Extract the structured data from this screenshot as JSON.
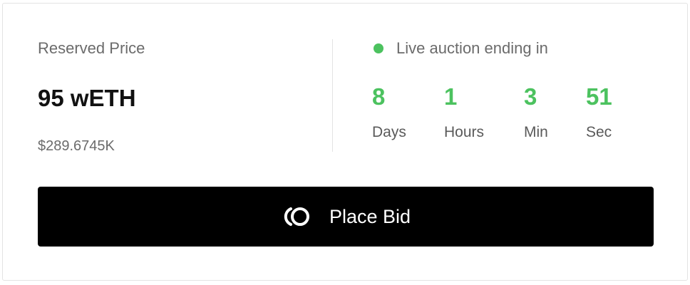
{
  "reserved": {
    "label": "Reserved Price",
    "amount": "95 wETH",
    "usd": "$289.6745K"
  },
  "auction": {
    "status_text": "Live auction ending in",
    "status_color": "#4cc25f",
    "countdown": [
      {
        "value": "8",
        "label": "Days"
      },
      {
        "value": "1",
        "label": "Hours"
      },
      {
        "value": "3",
        "label": "Min"
      },
      {
        "value": "51",
        "label": "Sec"
      }
    ]
  },
  "bid_button": {
    "label": "Place Bid",
    "icon": "bid-logo-icon",
    "background": "#000000"
  }
}
